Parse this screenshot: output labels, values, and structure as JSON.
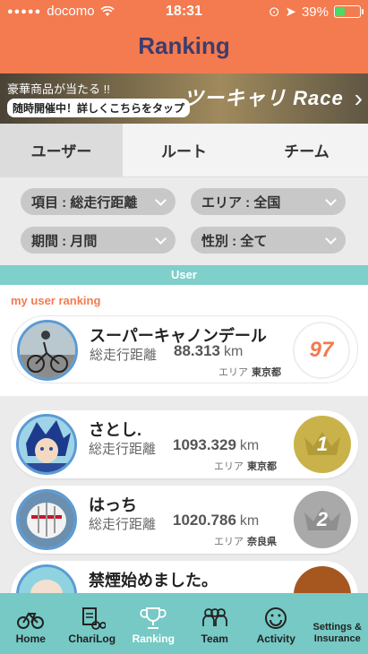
{
  "status": {
    "carrier": "docomo",
    "time": "18:31",
    "battery": "39%",
    "battery_level": 0.39
  },
  "header": {
    "title": "Ranking"
  },
  "banner": {
    "line1": "豪華商品が当たる !!",
    "line2": "随時開催中！詳しくこちらをタップ",
    "logo": "ツーキャリ Race"
  },
  "tabs": [
    {
      "label": "ユーザー"
    },
    {
      "label": "ルート"
    },
    {
      "label": "チーム"
    }
  ],
  "filters": {
    "item": "項目 : 総走行距離",
    "area": "エリア : 全国",
    "period": "期間 : 月間",
    "gender": "性別 : 全て"
  },
  "section_label": "User",
  "my_ranking": {
    "label": "my user ranking",
    "name": "スーパーキャノンデール",
    "metric": "総走行距離",
    "value": "88.313",
    "unit": "km",
    "area_label": "エリア",
    "area": "東京都",
    "rank": "97"
  },
  "rankings": [
    {
      "name": "さとし.",
      "metric": "総走行距離",
      "value": "1093.329",
      "unit": "km",
      "area_label": "エリア",
      "area": "東京都",
      "rank": "1"
    },
    {
      "name": "はっち",
      "metric": "総走行距離",
      "value": "1020.786",
      "unit": "km",
      "area_label": "エリア",
      "area": "奈良県",
      "rank": "2"
    },
    {
      "name": "禁煙始めました。",
      "metric": "",
      "value": "",
      "unit": "",
      "area_label": "",
      "area": "",
      "rank": ""
    }
  ],
  "nav": [
    {
      "label": "Home",
      "icon": "bicycle-icon"
    },
    {
      "label": "ChariLog",
      "icon": "clipboard-bicycle-icon"
    },
    {
      "label": "Ranking",
      "icon": "trophy-icon"
    },
    {
      "label": "Team",
      "icon": "team-icon"
    },
    {
      "label": "Activity",
      "icon": "smiley-icon"
    },
    {
      "label": "Settings & Insurance",
      "icon": "gear-icon"
    }
  ],
  "colors": {
    "header": "#f47a4f",
    "teal": "#76c9c4",
    "title": "#3d3d6b",
    "gold": "#c9b24a",
    "silver": "#a9a9a9",
    "bronze": "#a5571f"
  }
}
